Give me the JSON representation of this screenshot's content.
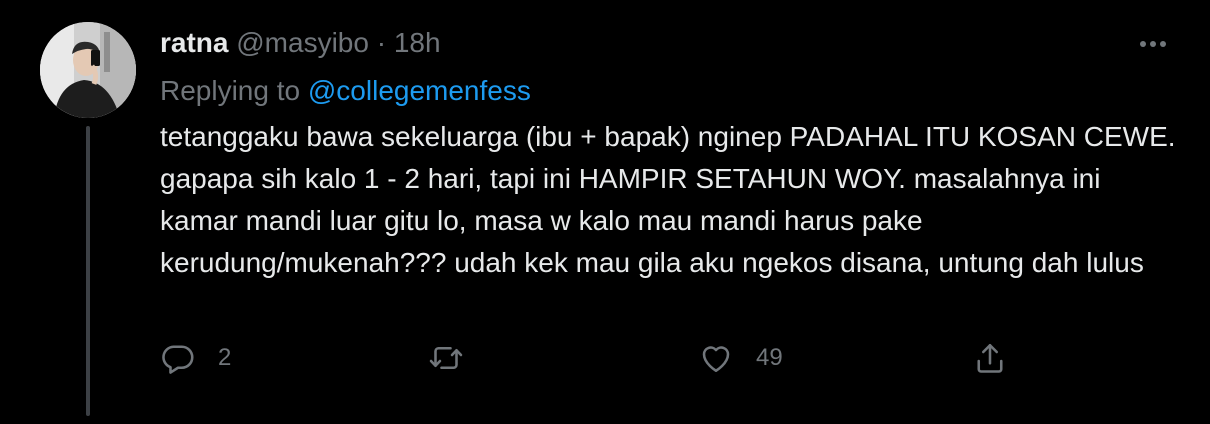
{
  "tweet": {
    "name": "ratna",
    "handle": "@masyibo",
    "separator": "·",
    "time": "18h",
    "replying_prefix": "Replying to",
    "replying_to": "@collegemenfess",
    "text": "tetanggaku bawa sekeluarga (ibu + bapak) nginep PADAHAL ITU KOSAN CEWE. gapapa sih kalo 1 - 2 hari, tapi ini HAMPIR SETAHUN WOY. masalahnya ini kamar mandi luar gitu lo, masa w kalo mau mandi harus pake kerudung/mukenah??? udah kek mau gila aku ngekos disana, untung dah lulus",
    "actions": {
      "reply_count": "2",
      "retweet_count": "",
      "like_count": "49"
    },
    "icons": {
      "reply": "reply-icon",
      "retweet": "retweet-icon",
      "like": "like-icon",
      "share": "share-icon",
      "more": "more-icon"
    },
    "colors": {
      "background": "#000000",
      "text": "#e7e9ea",
      "secondary": "#71767b",
      "link": "#1d9bf0",
      "thread_line": "#3c4045"
    }
  }
}
